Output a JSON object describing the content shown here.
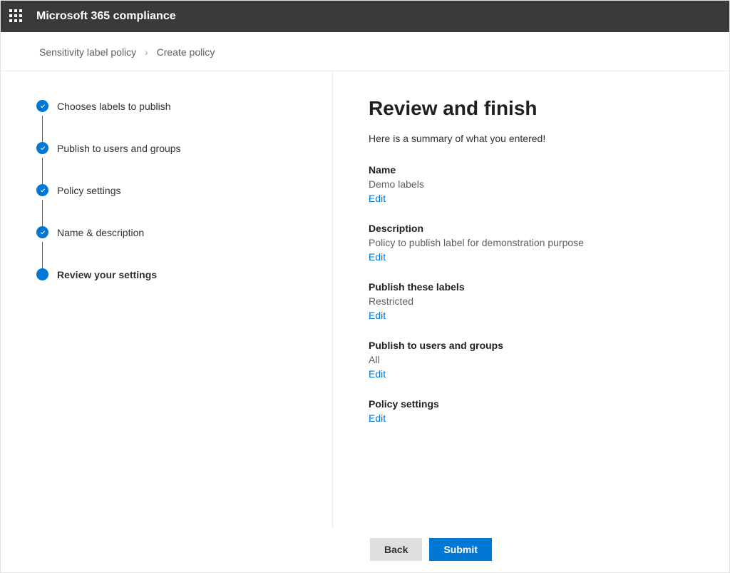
{
  "topbar": {
    "title": "Microsoft 365 compliance"
  },
  "breadcrumb": {
    "parent": "Sensitivity label policy",
    "current": "Create policy"
  },
  "steps": [
    {
      "label": "Chooses labels to publish",
      "done": true
    },
    {
      "label": "Publish to users and groups",
      "done": true
    },
    {
      "label": "Policy settings",
      "done": true
    },
    {
      "label": "Name & description",
      "done": true
    },
    {
      "label": "Review your settings",
      "current": true
    }
  ],
  "main": {
    "heading": "Review and finish",
    "intro": "Here is a summary of what you entered!",
    "edit_label": "Edit",
    "sections": {
      "name": {
        "title": "Name",
        "value": "Demo labels"
      },
      "description": {
        "title": "Description",
        "value": "Policy to publish label for demonstration purpose"
      },
      "publish_labels": {
        "title": "Publish these labels",
        "value": "Restricted"
      },
      "publish_users": {
        "title": "Publish to users and groups",
        "value": "All"
      },
      "policy_settings": {
        "title": "Policy settings",
        "value": ""
      }
    }
  },
  "footer": {
    "back": "Back",
    "submit": "Submit"
  }
}
